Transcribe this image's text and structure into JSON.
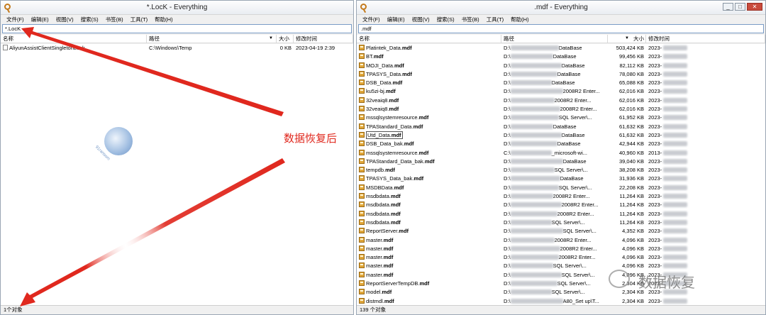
{
  "left": {
    "title": "*.LocK - Everything",
    "menu": [
      "文件(F)",
      "编辑(E)",
      "视图(V)",
      "搜索(S)",
      "书签(B)",
      "工具(T)",
      "帮助(H)"
    ],
    "search": "*.LocK",
    "columns": {
      "name": "名称",
      "path": "路径",
      "size": "大小",
      "modified": "修改时间"
    },
    "rows": [
      {
        "name": "AliyunAssistClientSingletonLock",
        "path": "C:\\Windows\\Temp",
        "size": "0 KB",
        "modified": "2023-04-19 2:39"
      }
    ],
    "status": "1个对象"
  },
  "right": {
    "title": ".mdf - Everything",
    "menu": [
      "文件(F)",
      "编辑(E)",
      "视图(V)",
      "搜索(S)",
      "书签(B)",
      "工具(T)",
      "帮助(H)"
    ],
    "search": ".mdf",
    "columns": {
      "name": "名称",
      "path": "路径",
      "size": "大小",
      "modified": "修改时间"
    },
    "rows": [
      {
        "name_plain": "Platintek_Data.",
        "name_bold": "mdf",
        "path_pre": "D:\\",
        "path_post": "DataBase",
        "size": "503,424 KB",
        "modified": "2023-"
      },
      {
        "name_plain": "BT.",
        "name_bold": "mdf",
        "path_pre": "D:\\",
        "path_post": "DataBase",
        "size": "99,456 KB",
        "modified": "2023-"
      },
      {
        "name_plain": "MOJI_Data.",
        "name_bold": "mdf",
        "path_pre": "D:\\",
        "path_post": "DataBase",
        "size": "82,112 KB",
        "modified": "2023-"
      },
      {
        "name_plain": "TPASYS_Data.",
        "name_bold": "mdf",
        "path_pre": "D:\\",
        "path_post": "DataBase",
        "size": "78,080 KB",
        "modified": "2023-"
      },
      {
        "name_plain": "DSB_Data.",
        "name_bold": "mdf",
        "path_pre": "D:\\",
        "path_post": "DataBase",
        "size": "65,088 KB",
        "modified": "2023-"
      },
      {
        "name_plain": "ku5zi-bj.",
        "name_bold": "mdf",
        "path_pre": "D:\\",
        "path_post": "2008R2 Enter...",
        "size": "62,016 KB",
        "modified": "2023-"
      },
      {
        "name_plain": "32veaiq8.",
        "name_bold": "mdf",
        "path_pre": "D:\\",
        "path_post": "2008R2 Enter...",
        "size": "62,016 KB",
        "modified": "2023-"
      },
      {
        "name_plain": "32veaiq8.",
        "name_bold": "mdf",
        "path_pre": "D:\\",
        "path_post": "2008R2 Enter...",
        "size": "62,016 KB",
        "modified": "2023-"
      },
      {
        "name_plain": "mssqlsystemresource.",
        "name_bold": "mdf",
        "path_pre": "D:\\",
        "path_post": "SQL Server\\...",
        "size": "61,952 KB",
        "modified": "2023-"
      },
      {
        "name_plain": "TPAStandard_Data.",
        "name_bold": "mdf",
        "path_pre": "D:\\",
        "path_post": "DataBase",
        "size": "61,632 KB",
        "modified": "2023-"
      },
      {
        "name_plain": "Utd_Data.",
        "name_bold": "mdf",
        "path_pre": "D:\\",
        "path_post": "DataBase",
        "size": "61,632 KB",
        "modified": "2023-",
        "boxed": true
      },
      {
        "name_plain": "DSB_Data_bak.",
        "name_bold": "mdf",
        "path_pre": "D:\\",
        "path_post": "DataBase",
        "size": "42,944 KB",
        "modified": "2023-"
      },
      {
        "name_plain": "mssqlsystemresource.",
        "name_bold": "mdf",
        "path_pre": "C:\\",
        "path_post": "_microsoft-wi...",
        "size": "40,960 KB",
        "modified": "2013-"
      },
      {
        "name_plain": "TPAStandard_Data_bak.",
        "name_bold": "mdf",
        "path_pre": "D:\\",
        "path_post": "DataBase",
        "size": "39,040 KB",
        "modified": "2023-"
      },
      {
        "name_plain": "tempdb.",
        "name_bold": "mdf",
        "path_pre": "D:\\",
        "path_post": "SQL Server\\...",
        "size": "38,208 KB",
        "modified": "2023-"
      },
      {
        "name_plain": "TPASYS_Data_bak.",
        "name_bold": "mdf",
        "path_pre": "D:\\",
        "path_post": "DataBase",
        "size": "31,936 KB",
        "modified": "2023-"
      },
      {
        "name_plain": "MSDBData.",
        "name_bold": "mdf",
        "path_pre": "D:\\",
        "path_post": "SQL Server\\...",
        "size": "22,208 KB",
        "modified": "2023-"
      },
      {
        "name_plain": "msdbdata.",
        "name_bold": "mdf",
        "path_pre": "D:\\",
        "path_post": "2008R2 Enter...",
        "size": "11,264 KB",
        "modified": "2023-"
      },
      {
        "name_plain": "msdbdata.",
        "name_bold": "mdf",
        "path_pre": "D:\\",
        "path_post": "2008R2 Enter...",
        "size": "11,264 KB",
        "modified": "2023-"
      },
      {
        "name_plain": "msdbdata.",
        "name_bold": "mdf",
        "path_pre": "D:\\",
        "path_post": "2008R2 Enter...",
        "size": "11,264 KB",
        "modified": "2023-"
      },
      {
        "name_plain": "msdbdata.",
        "name_bold": "mdf",
        "path_pre": "D:\\",
        "path_post": "SQL Server\\...",
        "size": "11,264 KB",
        "modified": "2023-"
      },
      {
        "name_plain": "ReportServer.",
        "name_bold": "mdf",
        "path_pre": "D:\\",
        "path_post": "SQL Server\\...",
        "size": "4,352 KB",
        "modified": "2023-"
      },
      {
        "name_plain": "master.",
        "name_bold": "mdf",
        "path_pre": "D:\\",
        "path_post": "2008R2 Enter...",
        "size": "4,096 KB",
        "modified": "2023-"
      },
      {
        "name_plain": "master.",
        "name_bold": "mdf",
        "path_pre": "D:\\",
        "path_post": "2008R2 Enter...",
        "size": "4,096 KB",
        "modified": "2023-"
      },
      {
        "name_plain": "master.",
        "name_bold": "mdf",
        "path_pre": "D:\\",
        "path_post": "2008R2 Enter...",
        "size": "4,096 KB",
        "modified": "2023-"
      },
      {
        "name_plain": "master.",
        "name_bold": "mdf",
        "path_pre": "D:\\",
        "path_post": "SQL Server\\...",
        "size": "4,096 KB",
        "modified": "2023-"
      },
      {
        "name_plain": "master.",
        "name_bold": "mdf",
        "path_pre": "D:\\",
        "path_post": "SQL Server\\...",
        "size": "4,096 KB",
        "modified": "2023-"
      },
      {
        "name_plain": "ReportServerTempDB.",
        "name_bold": "mdf",
        "path_pre": "D:\\",
        "path_post": "SQL Server\\...",
        "size": "2,304 KB",
        "modified": "2023-"
      },
      {
        "name_plain": "model.",
        "name_bold": "mdf",
        "path_pre": "D:\\",
        "path_post": "SQL Server\\...",
        "size": "2,304 KB",
        "modified": "2023-"
      },
      {
        "name_plain": "distmdl.",
        "name_bold": "mdf",
        "path_pre": "D:\\",
        "path_post": "A80_Set up\\T...",
        "size": "2,304 KB",
        "modified": "2023-"
      }
    ],
    "status": "139 个对象"
  },
  "annotation": {
    "label": "数据恢复后",
    "color": "#e0281e"
  },
  "watermark": {
    "text": "数据恢复"
  },
  "logo": {
    "text": "91ransom"
  },
  "colors": {
    "accent": "#e0281e",
    "selection_border": "#7a9cc6",
    "db_icon": "#e0a63a"
  }
}
